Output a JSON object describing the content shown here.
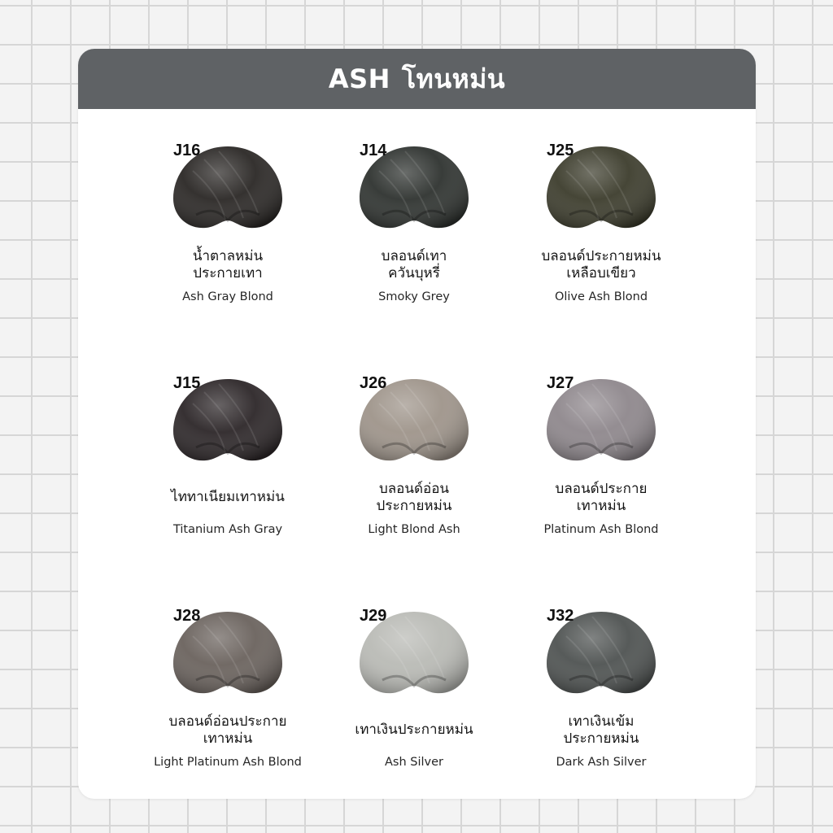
{
  "header": {
    "title_en": "ASH",
    "title_th": "โทนหม่น"
  },
  "items": [
    {
      "code": "J16",
      "thai": [
        "น้ำตาลหม่น",
        "ประกายเทา"
      ],
      "english": "Ash Gray Blond",
      "color": "#2a2725"
    },
    {
      "code": "J14",
      "thai": [
        "บลอนด์เทา",
        "ควันบุหรี่"
      ],
      "english": "Smoky Grey",
      "color": "#2e322f"
    },
    {
      "code": "J25",
      "thai": [
        "บลอนด์ประกายหม่น",
        "เหลือบเขียว"
      ],
      "english": "Olive Ash Blond",
      "color": "#3c3c2c"
    },
    {
      "code": "J15",
      "thai": [
        "ไททาเนียมเทาหม่น"
      ],
      "english": "Titanium Ash Gray",
      "color": "#2c2628"
    },
    {
      "code": "J26",
      "thai": [
        "บลอนด์อ่อน",
        "ประกายหม่น"
      ],
      "english": "Light Blond Ash",
      "color": "#9e948a"
    },
    {
      "code": "J27",
      "thai": [
        "บลอนด์ประกาย",
        "เทาหม่น"
      ],
      "english": "Platinum Ash Blond",
      "color": "#8e878c"
    },
    {
      "code": "J28",
      "thai": [
        "บลอนด์อ่อนประกาย",
        "เทาหม่น"
      ],
      "english": "Light Platinum Ash Blond",
      "color": "#6a625d"
    },
    {
      "code": "J29",
      "thai": [
        "เทาเงินประกายหม่น"
      ],
      "english": "Ash Silver",
      "color": "#b9bab5"
    },
    {
      "code": "J32",
      "thai": [
        "เทาเงินเข้ม",
        "ประกายหม่น"
      ],
      "english": "Dark Ash Silver",
      "color": "#4e5251"
    }
  ]
}
